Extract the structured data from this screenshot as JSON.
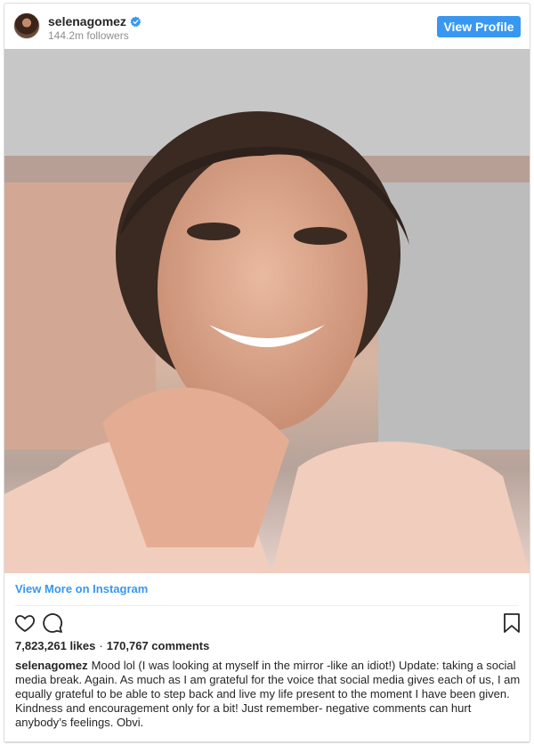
{
  "header": {
    "username": "selenagomez",
    "followers": "144.2m followers",
    "view_profile_label": "View Profile"
  },
  "post": {
    "view_more_label": "View More on Instagram",
    "likes": "7,823,261 likes",
    "comments": "170,767 comments",
    "caption_user": "selenagomez",
    "caption_text": "Mood lol (I was looking at myself in the mirror -like an idiot!) Update: taking a social media break. Again. As much as I am grateful for the voice that social media gives each of us, I am equally grateful to be able to step back and live my life present to the moment I have been given. Kindness and encouragement only for a bit! Just remember- negative comments can hurt anybody’s feelings. Obvi."
  },
  "colors": {
    "accent": "#3897f0",
    "text": "#262626",
    "muted": "#8e8e8e",
    "border": "#dbdbdb"
  },
  "icons": [
    "verified-badge-icon",
    "heart-icon",
    "comment-icon",
    "bookmark-icon"
  ]
}
